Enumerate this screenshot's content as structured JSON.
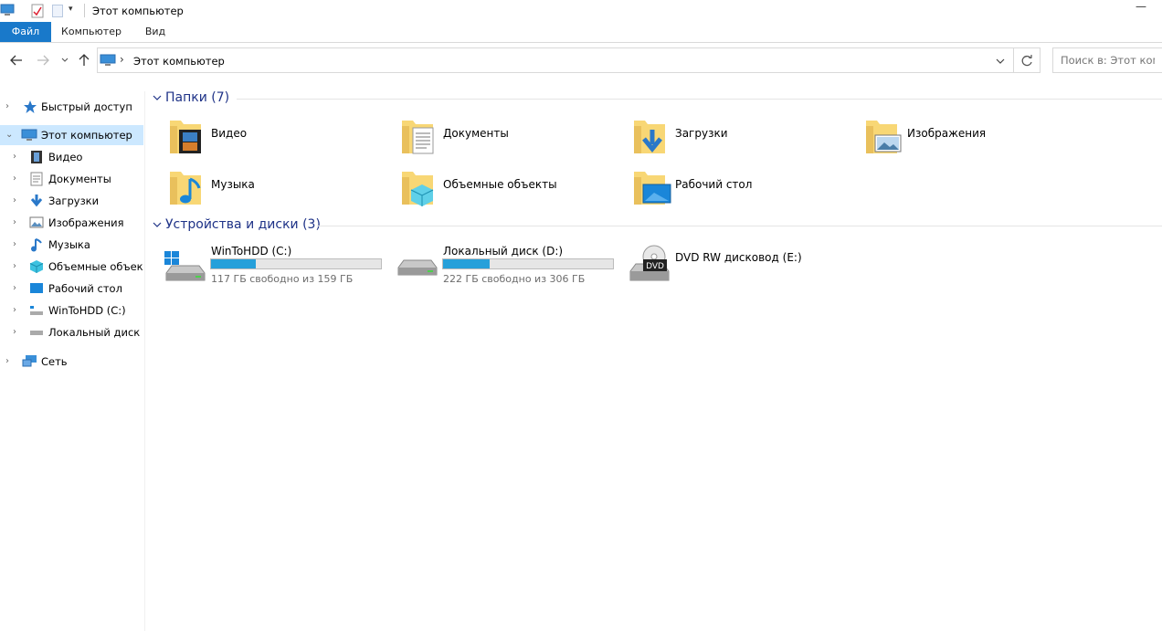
{
  "window": {
    "title": "Этот компьютер",
    "minimize_label": "—"
  },
  "ribbon": {
    "tabs": [
      {
        "label": "Файл"
      },
      {
        "label": "Компьютер"
      },
      {
        "label": "Вид"
      }
    ]
  },
  "address_bar": {
    "path": "Этот компьютер",
    "separator": "›"
  },
  "search": {
    "placeholder": "Поиск в: Этот компьютер"
  },
  "sidebar": {
    "quick_access": "Быстрый доступ",
    "this_pc": "Этот компьютер",
    "children": [
      {
        "label": "Видео",
        "icon": "video-icon"
      },
      {
        "label": "Документы",
        "icon": "documents-icon"
      },
      {
        "label": "Загрузки",
        "icon": "downloads-icon"
      },
      {
        "label": "Изображения",
        "icon": "pictures-icon"
      },
      {
        "label": "Музыка",
        "icon": "music-icon"
      },
      {
        "label": "Объемные объекты",
        "icon": "3d-objects-icon"
      },
      {
        "label": "Рабочий стол",
        "icon": "desktop-icon"
      },
      {
        "label": "WinToHDD (C:)",
        "icon": "drive-c-icon"
      },
      {
        "label": "Локальный диск (D:)",
        "icon": "drive-d-icon"
      }
    ],
    "network": "Сеть"
  },
  "folders_section": {
    "header": "Папки (7)",
    "items": [
      {
        "label": "Видео",
        "icon": "video-folder-icon"
      },
      {
        "label": "Документы",
        "icon": "documents-folder-icon"
      },
      {
        "label": "Загрузки",
        "icon": "downloads-folder-icon"
      },
      {
        "label": "Изображения",
        "icon": "pictures-folder-icon"
      },
      {
        "label": "Музыка",
        "icon": "music-folder-icon"
      },
      {
        "label": "Объемные объекты",
        "icon": "3d-objects-folder-icon"
      },
      {
        "label": "Рабочий стол",
        "icon": "desktop-folder-icon"
      }
    ]
  },
  "devices_section": {
    "header": "Устройства и диски (3)",
    "drives": [
      {
        "label": "WinToHDD (C:)",
        "free_text": "117 ГБ свободно из 159 ГБ",
        "used_fraction": 0.264,
        "icon": "windows-drive-icon"
      },
      {
        "label": "Локальный диск (D:)",
        "free_text": "222 ГБ свободно из 306 ГБ",
        "used_fraction": 0.275,
        "icon": "hard-drive-icon"
      },
      {
        "label": "DVD RW дисковод (E:)",
        "disc_badge": "DVD",
        "icon": "dvd-drive-icon"
      }
    ]
  },
  "colors": {
    "accent": "#1979ca",
    "selection": "#cce8ff",
    "section_header": "#1e3287",
    "progress": "#26a0da",
    "folder": "#f8d775"
  }
}
